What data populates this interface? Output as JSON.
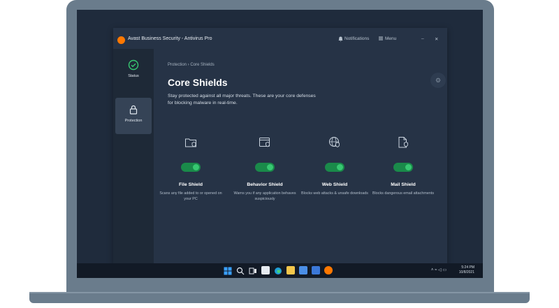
{
  "window": {
    "title": "Avast Business Security - Antivirus Pro",
    "notifications_label": "Notifications",
    "menu_label": "Menu",
    "minimize_glyph": "_",
    "close_glyph": "✕"
  },
  "sidebar": {
    "items": [
      {
        "label": "Status",
        "icon": "check-circle-icon",
        "active": false
      },
      {
        "label": "Protection",
        "icon": "lock-icon",
        "active": true
      }
    ]
  },
  "main": {
    "breadcrumb": "Protection › Core Shields",
    "heading": "Core Shields",
    "description": "Stay protected against all major threats. These are your core defenses for blocking malware in real-time.",
    "shields": [
      {
        "name": "File Shield",
        "description": "Scans any file added to or opened on your PC",
        "enabled": true,
        "icon": "folder-shield-icon"
      },
      {
        "name": "Behavior Shield",
        "description": "Warns you if any application behaves suspiciously",
        "enabled": true,
        "icon": "window-shield-icon"
      },
      {
        "name": "Web Shield",
        "description": "Blocks web attacks & unsafe downloads",
        "enabled": true,
        "icon": "globe-shield-icon"
      },
      {
        "name": "Mail Shield",
        "description": "Blocks dangerous email attachments",
        "enabled": true,
        "icon": "document-shield-icon"
      }
    ]
  },
  "taskbar": {
    "time": "5:24 PM",
    "date": "10/8/2021"
  },
  "colors": {
    "accent_orange": "#ff7800",
    "toggle_on": "#37c871",
    "window_bg": "#263346",
    "sidebar_bg": "#1e2937"
  }
}
